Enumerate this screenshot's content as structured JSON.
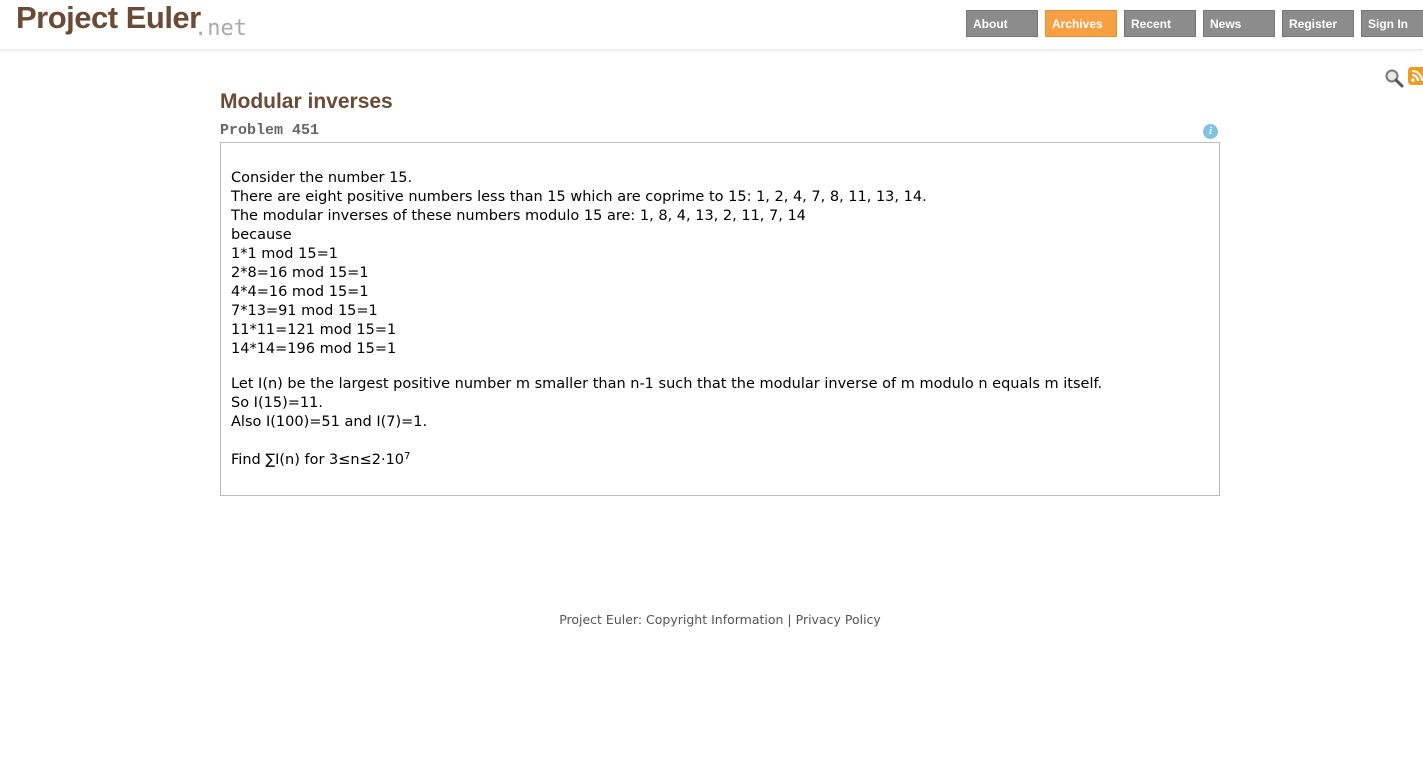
{
  "header": {
    "logo_main": "Project Euler",
    "logo_suffix": ".net",
    "nav": [
      {
        "label": "About",
        "active": false
      },
      {
        "label": "Archives",
        "active": true
      },
      {
        "label": "Recent",
        "active": false
      },
      {
        "label": "News",
        "active": false
      },
      {
        "label": "Register",
        "active": false
      },
      {
        "label": "Sign In",
        "active": false
      }
    ]
  },
  "tools": {
    "search_icon": "search-icon",
    "rss_icon": "rss-icon"
  },
  "problem": {
    "title": "Modular inverses",
    "number_label": "Problem 451",
    "info_icon": "i",
    "lines": [
      "Consider the number 15.",
      "There are eight positive numbers less than 15 which are coprime to 15: 1, 2, 4, 7, 8, 11, 13, 14.",
      "The modular inverses of these numbers modulo 15 are: 1, 8, 4, 13, 2, 11, 7, 14",
      "because",
      "1*1 mod 15=1",
      "2*8=16 mod 15=1",
      "4*4=16 mod 15=1",
      "7*13=91 mod 15=1",
      "11*11=121 mod 15=1",
      "14*14=196 mod 15=1"
    ],
    "lines2": [
      "Let I(n) be the largest positive number m smaller than n-1 such that the modular inverse of m modulo n equals m itself.",
      "So I(15)=11.",
      "Also I(100)=51 and I(7)=1."
    ],
    "find_text": "Find ∑I(n) for 3≤n≤2·10",
    "find_sup": "7"
  },
  "footer": {
    "prefix": "Project Euler: ",
    "copyright_link": "Copyright Information",
    "separator": " | ",
    "privacy_link": "Privacy Policy"
  },
  "colors": {
    "brand": "#6b4a36",
    "nav_bg": "#8c8c8c",
    "nav_active": "#f7a043",
    "rss": "#f59a21",
    "info": "#7fc2e3"
  }
}
